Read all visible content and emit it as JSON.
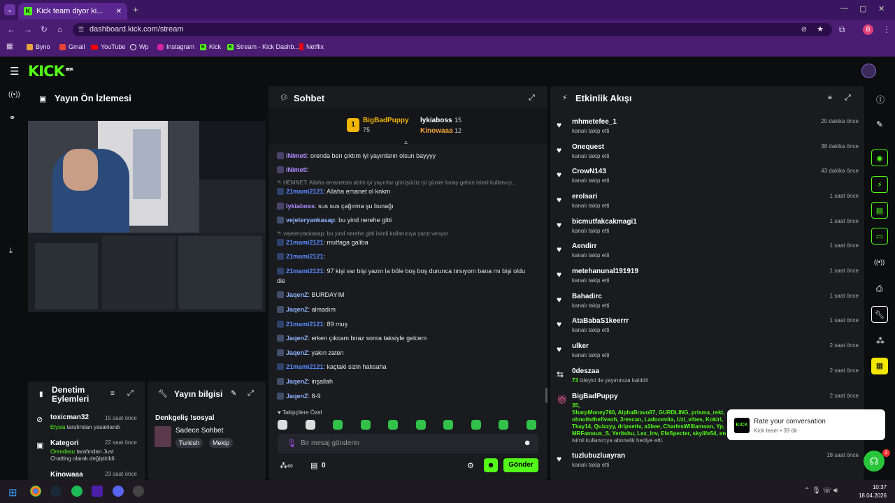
{
  "browser": {
    "tab_title": "Kick team diyor ki...",
    "url": "dashboard.kick.com/stream",
    "bookmarks": [
      "Byno",
      "Gmail",
      "YouTube",
      "Wp",
      "Instagram",
      "Kick",
      "Stream - Kick Dashb...",
      "Netflix"
    ],
    "profile": "B"
  },
  "app": {
    "logo": "KICK",
    "beta": "BETA"
  },
  "preview": {
    "title": "Yayın Ön İzlemesi"
  },
  "chat": {
    "title": "Sohbet",
    "leaders": [
      {
        "rank": "1",
        "name": "BigBadPuppy",
        "count": "75"
      },
      {
        "name": "lykiaboss",
        "count": "15"
      },
      {
        "name": "Kinowaaa",
        "count": "12"
      }
    ],
    "messages": [
      {
        "user": "lNimetl",
        "color": "#b18cff",
        "text": ": orenda ben çıktım iyi yayınların olsun bayyyy"
      },
      {
        "user": "lNimetl",
        "color": "#b18cff",
        "text": ":"
      },
      {
        "reply": "HEMNET: Allaha emanetsin abim iyi yayınlar görüşürüz iyi günler kolay gelsin isimli kullanıcy..."
      },
      {
        "user": "21mami2121",
        "color": "#5b8cff",
        "text": ": Allaha emanet ol knkm"
      },
      {
        "user": "lykiaboss",
        "color": "#b18cff",
        "text": ": sus sus çağırma şu bunağı"
      },
      {
        "user": "vejeteryankasap",
        "color": "#8fb4ff",
        "text": ": bu yind nerehe gitti"
      },
      {
        "reply": "vejeteryankasap: bu yind nerehe gitti isimli kullanıcıya yanıt veriyor"
      },
      {
        "user": "21mami2121",
        "color": "#5b8cff",
        "text": ": mutfaga galiba"
      },
      {
        "user": "21mami2121",
        "color": "#5b8cff",
        "text": ":"
      },
      {
        "user": "21mami2121",
        "color": "#5b8cff",
        "text": ": 97 kişi var bişi yazın la böle boş boş durunca tırsıyom bana mı bişi oldu"
      },
      {
        "cont": "die"
      },
      {
        "user": "JaqenZ",
        "color": "#8fb4ff",
        "text": ": BURDAYIM"
      },
      {
        "user": "JaqenZ",
        "color": "#8fb4ff",
        "text": ": almadım"
      },
      {
        "user": "21mami2121",
        "color": "#5b8cff",
        "text": ": 89 muş"
      },
      {
        "user": "JaqenZ",
        "color": "#8fb4ff",
        "text": ": erken çıkcam biraz sonra taksiyle gelcem"
      },
      {
        "user": "JaqenZ",
        "color": "#8fb4ff",
        "text": ": yakın zaten"
      },
      {
        "user": "21mami2121",
        "color": "#5b8cff",
        "text": ": kaçtaki sizin halısaha"
      },
      {
        "user": "JaqenZ",
        "color": "#8fb4ff",
        "text": ": inşallah"
      },
      {
        "user": "JaqenZ",
        "color": "#8fb4ff",
        "text": ": 8-9"
      }
    ],
    "emote_tab": "Takipçilere Özel",
    "input_placeholder": "Bir mesaj gönderin",
    "count": "0",
    "send": "Gönder"
  },
  "mod": {
    "title": "Denetim Eylemleri",
    "items": [
      {
        "user": "toxicman32",
        "time": "15 saat önce",
        "by": "Elysia",
        "rest": " tarafından yasaklandı"
      },
      {
        "user": "Kategori",
        "time": "22 saat önce",
        "by": "Orendasu",
        "rest": " tarafından Just Chatting olarak değiştirildi"
      },
      {
        "user": "Kinowaaa",
        "time": "23 saat önce"
      }
    ]
  },
  "info": {
    "title": "Yayın bilgisi",
    "stream_title": "Denkgeliş !sosyal",
    "category": "Sadece Sohbet",
    "tags": [
      "Turkish",
      "Mekip"
    ]
  },
  "events": {
    "title": "Etkinlik Akışı",
    "items": [
      {
        "name": "mhmetefee_1",
        "sub": "kanalı takip etti",
        "time": "20 dakika önce",
        "icon": "♥"
      },
      {
        "name": "Onequest",
        "sub": "kanalı takip etti",
        "time": "38 dakika önce",
        "icon": "♥"
      },
      {
        "name": "CrowN143",
        "sub": "kanalı takip etti",
        "time": "43 dakika önce",
        "icon": "♥"
      },
      {
        "name": "erolsari",
        "sub": "kanalı takip etti",
        "time": "1 saat önce",
        "icon": "♥"
      },
      {
        "name": "bicmutfakcakmagi1",
        "sub": "kanalı takip etti",
        "time": "1 saat önce",
        "icon": "♥"
      },
      {
        "name": "Aendirr",
        "sub": "kanalı takip etti",
        "time": "1 saat önce",
        "icon": "♥"
      },
      {
        "name": "metehanunal191919",
        "sub": "kanalı takip etti",
        "time": "1 saat önce",
        "icon": "♥"
      },
      {
        "name": "Bahadirc",
        "sub": "kanalı takip etti",
        "time": "1 saat önce",
        "icon": "♥"
      },
      {
        "name": "AtaBabaS1keerrr",
        "sub": "kanalı takip etti",
        "time": "1 saat önce",
        "icon": "♥"
      },
      {
        "name": "ulker",
        "sub": "kanalı takip etti",
        "time": "2 saat önce",
        "icon": "♥"
      },
      {
        "name": "0deszaa",
        "num": "73",
        "sub": " izleyici ile yayınınıza katıldı!",
        "time": "2 saat önce",
        "icon": "⇆"
      }
    ],
    "gift": {
      "name": "BigBadPuppy",
      "time": "2 saat önce",
      "count": "35,",
      "users": "SharpMoney760, AlphaBravo87, GURDLING, prisma_rekt, ohnoitsthefiveoh, 3rescan, Ladocevita, Uzi_vibes, Kokiri, Tkay14, Quizzyy, dripsettv, a1bee, CharlesWilliamson, Yp, MRFamous_S, Yeritshu, Lex_Inv, EfeSpecter, skylife54, en",
      "tail": "isimli kullanıcıya abonelik hediye etti."
    },
    "last": {
      "name": "tuzlubuzluayran",
      "sub": "kanalı takip etti",
      "time": "18 saat önce"
    }
  },
  "toast": {
    "title": "Rate your conversation",
    "sub": "Kick team • 39 dk",
    "badge": "2"
  },
  "taskbar": {
    "time": "10:37",
    "date": "18.04.2026"
  }
}
